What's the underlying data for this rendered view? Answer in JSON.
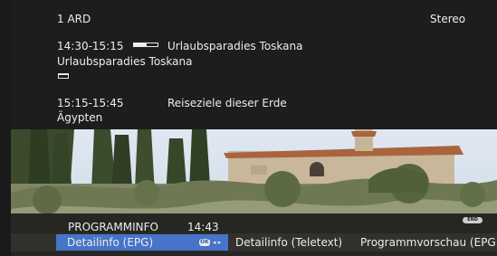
{
  "channel": {
    "label": "1 ARD",
    "audio_mode": "Stereo"
  },
  "now_program": {
    "time": "14:30-15:15",
    "title": "Urlaubsparadies Toskana",
    "subtitle": "Urlaubsparadies Toskana",
    "progress_fraction": 0.55
  },
  "next_program": {
    "time": "15:15-15:45",
    "title": "Reiseziele dieser Erde",
    "subtitle": "Ägypten"
  },
  "menu": {
    "title": "PROGRAMMINFO",
    "clock": "14:43",
    "end_button": "END",
    "tabs": {
      "epg": "Detailinfo (EPG)",
      "teletext": "Detailinfo (Teletext)",
      "preview": "Programmvorschau (EPG)"
    },
    "ok_label": "OK"
  },
  "colors": {
    "accent": "#4674c8",
    "background": "#1d1d1d",
    "text": "#ececec"
  }
}
